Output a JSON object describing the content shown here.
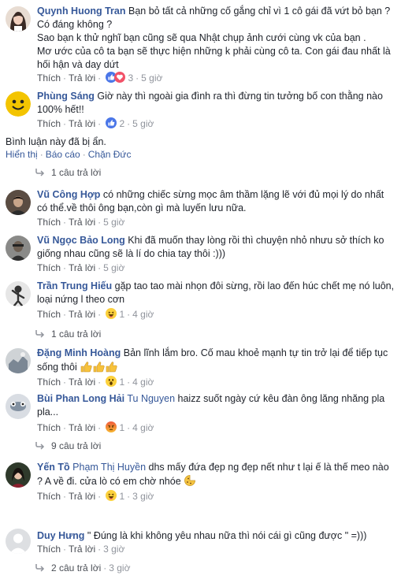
{
  "actions": {
    "like": "Thích",
    "reply": "Trả lời"
  },
  "comments": [
    {
      "author": "Quynh Huong Tran",
      "text": "Bạn bỏ tất cả những cố gắng chỉ vì 1 cô gái đã vứt bỏ bạn ? Có đáng không ?\nSao bạn k thử nghĩ bạn cũng sẽ qua Nhật chụp ảnh cưới cùng vk của bạn .\nMơ ước của cô ta bạn sẽ thực hiện những k phải cùng cô ta. Con gái đau nhất là hối hận và day dứt",
      "reaction_count": "3",
      "time": "5 giờ",
      "reaction": "like-heart"
    },
    {
      "author": "Phùng Sáng",
      "text": "Giờ này thì ngoài gia đình ra thì đừng tin tưởng bố con thằng nào 100% hết!!",
      "reaction_count": "2",
      "time": "5 giờ",
      "reaction": "like"
    },
    {
      "author": "Vũ Công Hợp",
      "text": "có những chiếc sừng mọc âm thầm lặng lẽ với đủ mọi lý do nhất có thể.về thôi ông bạn,còn gì mà luyến lưu nữa.",
      "time": "5 giờ"
    },
    {
      "author": "Vũ Ngọc Bảo Long",
      "text": "Khi đã muốn thay lòng rồi thì chuyện nhỏ nhưu sở thích ko giống nhau cũng sẽ là lí do chia tay thôi :)))",
      "time": "5 giờ"
    },
    {
      "author": "Trần Trung Hiếu",
      "text": "gặp tao tao mài nhọn đôi sừng, rồi lao đến húc chết mẹ nó luôn, loại nứng l theo cơn",
      "reaction_count": "1",
      "time": "4 giờ",
      "reaction": "haha"
    },
    {
      "author": "Đặng Minh Hoàng",
      "text": "Bản lĩnh lắm bro. Cố mau khoẻ mạnh tự tin trở lại để tiếp tục sống thôi",
      "reaction_count": "1",
      "time": "4 giờ",
      "reaction": "wow"
    },
    {
      "author": "Bùi Phan Long Hải",
      "tag": "Tu Nguyen",
      "text": "haizz suốt ngày cứ kêu đàn ông lăng nhăng pla pla...",
      "reaction_count": "1",
      "time": "4 giờ",
      "reaction": "angry"
    },
    {
      "author": "Yến Tồ",
      "tag": "Phạm Thị Huyền",
      "text": "dhs mấy đứa đẹp ng đẹp nết như t lại ế là thế meo nào ? A về đi. cửa lò có em chờ nhóe",
      "reaction_count": "1",
      "time": "3 giờ",
      "reaction": "haha"
    },
    {
      "author": "Duy Hưng",
      "text": "\" Đúng là khi không yêu nhau nữa thì nói cái gì cũng được \" =)))",
      "time": "3 giờ"
    }
  ],
  "hidden": {
    "note": "Bình luận này đã bị ẩn.",
    "show": "Hiển thị",
    "report": "Báo cáo",
    "block": "Chặn Đức"
  },
  "replies": {
    "r1": "1 câu trả lời",
    "r2": "1 câu trả lời",
    "r3": "9 câu trả lời",
    "r4": "2 câu trả lời",
    "r4_time": "3 giờ"
  },
  "colors": {
    "link": "#365899",
    "meta": "#90949c",
    "like_blue": "#4a76e8",
    "heart_red": "#f25268",
    "haha_yellow": "#fcd13d",
    "angry_orange": "#f06a2a"
  }
}
